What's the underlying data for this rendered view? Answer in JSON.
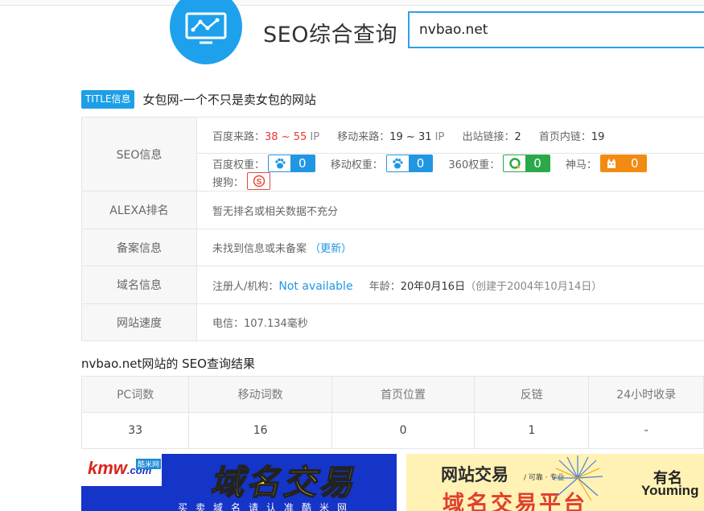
{
  "header": {
    "title": "SEO综合查询",
    "search_value": "nvbao.net"
  },
  "site_title": {
    "badge": "TITLE信息",
    "text": "女包网-一个不只是卖女包的网站"
  },
  "seo": {
    "label": "SEO信息",
    "baidu_traffic_label": "百度来路：",
    "baidu_traffic_low": "38",
    "baidu_traffic_sep": " ~ ",
    "baidu_traffic_high": "55",
    "baidu_traffic_unit": " IP",
    "mobile_traffic_label": "移动来路：",
    "mobile_traffic_value": "19 ~ 31",
    "mobile_traffic_unit": " IP",
    "outlinks_label": "出站链接：",
    "outlinks_value": "2",
    "inlinks_label": "首页内链：",
    "inlinks_value": "19",
    "weights": [
      {
        "label": "百度权重：",
        "value": "0",
        "icon": "baidu-paw-icon",
        "color": "#2196e3"
      },
      {
        "label": "移动权重：",
        "value": "0",
        "icon": "baidu-paw-icon",
        "color": "#2196e3"
      },
      {
        "label": "360权重：",
        "value": "0",
        "icon": "360-icon",
        "color": "#2aa84a"
      },
      {
        "label": "神马：",
        "value": "0",
        "icon": "shenma-icon",
        "color": "#f28b12"
      },
      {
        "label": "搜狗：",
        "value": "",
        "icon": "sogou-icon",
        "color": "#e8483b"
      }
    ]
  },
  "alexa": {
    "label": "ALEXA排名",
    "value": "暂无排名或相关数据不充分"
  },
  "beian": {
    "label": "备案信息",
    "value": "未找到信息或未备案",
    "update_link": "（更新）"
  },
  "domain": {
    "label": "域名信息",
    "registrant_label": "注册人/机构：",
    "registrant_value": "Not available",
    "age_label": "年龄：",
    "age_value": "20年0月16日",
    "created": "（创建于2004年10月14日）"
  },
  "speed": {
    "label": "网站速度",
    "value": "电信：107.134毫秒"
  },
  "results": {
    "title": "nvbao.net网站的 SEO查询结果",
    "headers": [
      "PC词数",
      "移动词数",
      "首页位置",
      "反链",
      "24小时收录"
    ],
    "row": [
      "33",
      "16",
      "0",
      "1",
      "-"
    ]
  },
  "ads": {
    "left_logo": "kmw",
    "left_logo_suffix": ".com",
    "left_logo_tag": "酷米网",
    "left_title": "域名交易",
    "left_sub": "买卖域名请认准酷米网",
    "right_title1": "网站交易",
    "right_title1_sub": "/ 可靠 · 专业",
    "right_title2": "域名交易平台",
    "right_brand_cn": "有名",
    "right_brand_en": "Youming"
  },
  "colors": {
    "accent": "#1d9fe8",
    "red": "#e33333",
    "link": "#2196e3"
  }
}
